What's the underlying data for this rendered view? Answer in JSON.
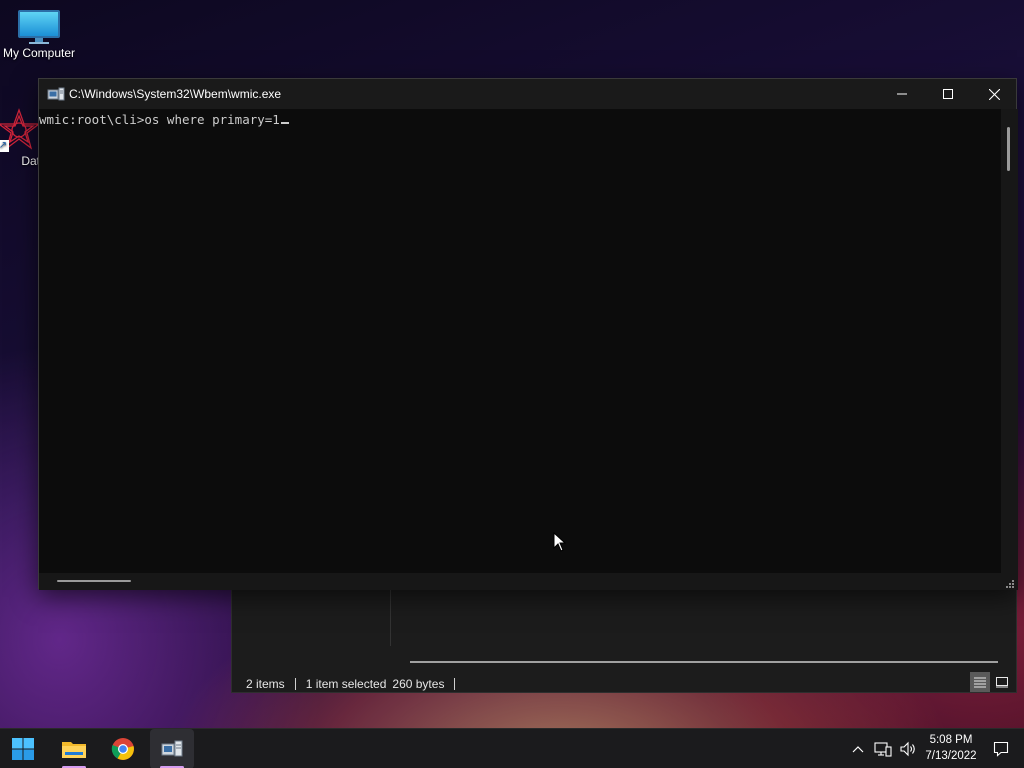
{
  "desktop": {
    "icons": [
      {
        "label": "My Computer",
        "icon": "monitor-icon"
      },
      {
        "label": "DataW",
        "icon": "datawatch-star-icon"
      }
    ]
  },
  "console": {
    "title": "C:\\Windows\\System32\\Wbem\\wmic.exe",
    "prompt": "wmic:root\\cli>",
    "input": "os where primary=1"
  },
  "explorer_status": {
    "items": "2 items",
    "selected": "1 item selected",
    "size": "260 bytes"
  },
  "taskbar": {
    "apps": [
      "start-icon",
      "file-explorer-icon",
      "chrome-icon",
      "wmic-icon"
    ],
    "active_app": "wmic",
    "time": "5:08 PM",
    "date": "7/13/2022"
  },
  "colors": {
    "console_bg": "#0c0c0c",
    "console_text": "#cccccc",
    "taskbar_bg": "#1b1b1d",
    "active_indicator": "#d59cf0"
  }
}
